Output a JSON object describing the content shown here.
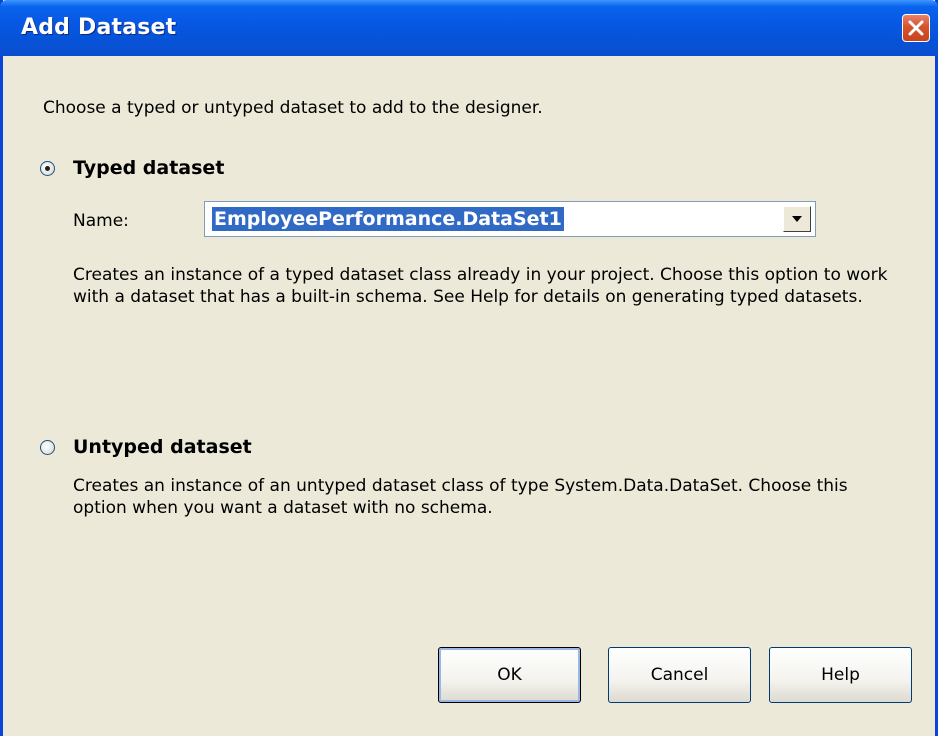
{
  "window": {
    "title": "Add Dataset",
    "close_icon": "close-icon"
  },
  "intro_text": "Choose a typed or untyped dataset to add to the designer.",
  "typed": {
    "label": "Typed dataset",
    "checked": true,
    "name_label": "Name:",
    "name_value": "EmployeePerformance.DataSet1",
    "description": "Creates an instance of a typed dataset class already in your project. Choose this option to work with a dataset that has a built-in schema. See Help for details on generating typed datasets."
  },
  "untyped": {
    "label": "Untyped dataset",
    "checked": false,
    "description": "Creates an instance of an untyped dataset class of type System.Data.DataSet. Choose this option when you want a dataset with no schema."
  },
  "buttons": {
    "ok": "OK",
    "cancel": "Cancel",
    "help": "Help"
  },
  "colors": {
    "titlebar": "#0758e4",
    "selection": "#316ac5",
    "dialog_bg": "#ece9d8"
  }
}
